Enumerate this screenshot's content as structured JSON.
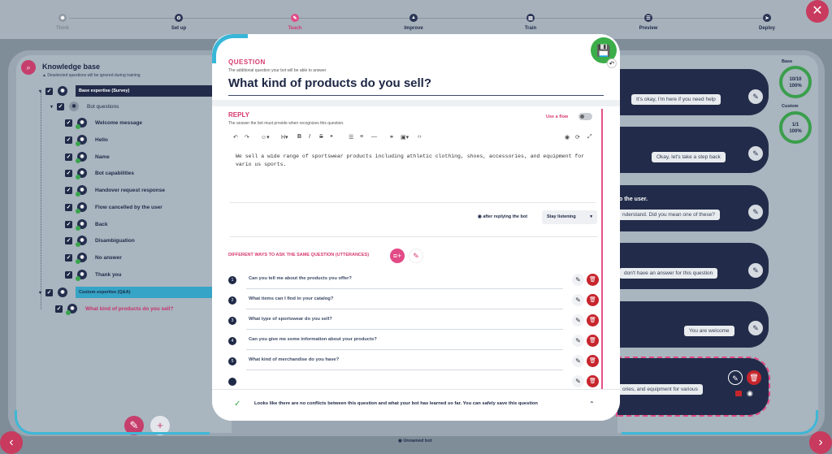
{
  "steps": [
    {
      "label": "Think",
      "icon": "✺"
    },
    {
      "label": "Set up",
      "icon": "⚙"
    },
    {
      "label": "Teach",
      "icon": "✎"
    },
    {
      "label": "Improve",
      "icon": "▲"
    },
    {
      "label": "Train",
      "icon": "▥"
    },
    {
      "label": "Preview",
      "icon": "☰"
    },
    {
      "label": "Deploy",
      "icon": "➤"
    }
  ],
  "knowledge_base": {
    "title": "Knowledge base",
    "subtitle": "▲ Deselected questions will be ignored during training",
    "base_category": "Base expertise (Survey)",
    "bot_questions": "Bot questions",
    "items": [
      "Welcome message",
      "Hello",
      "Name",
      "Bot capabilities",
      "Handover request response",
      "Flow cancelled by the user",
      "Back",
      "Disambiguation",
      "No answer",
      "Thank you"
    ],
    "custom_category": "Custom expertise (Q&A)",
    "custom_item": "What kind of products do you sell?"
  },
  "modal": {
    "question_label": "QUESTION",
    "question_hint": "The additional question your bot will be able to answer",
    "question_value": "What kind of products do you sell?",
    "reply_label": "REPLY",
    "reply_hint": "The answer the bot must provide when recognizes this question.",
    "use_flow": "Use a flow",
    "reply_text": "We sell a wide range of sportswear products including athletic clothing, shoes, accessories, and equipment for vario us sports.",
    "after_reply": "after replying the bot",
    "after_select": "Stay listening",
    "utterances_label": "DIFFERENT WAYS TO ASK THE SAME QUESTION (UTTERANCES)",
    "utterances": [
      {
        "n": "1",
        "text": "Can you tell me about the products you offer?"
      },
      {
        "n": "2",
        "text": "What items can I find in your catalog?"
      },
      {
        "n": "3",
        "text": "What type of sportswear do you sell?"
      },
      {
        "n": "4",
        "text": "Can you give me some information about your products?"
      },
      {
        "n": "5",
        "text": "What kind of merchandise do you have?"
      }
    ],
    "banner": "Looks like there are no conflicts between this question and what your bot has learned so far. You can safely save this question"
  },
  "right": {
    "gauge_base_label": "Base",
    "gauge_base": "10/10",
    "gauge_base_pct": "100%",
    "gauge_custom_label": "Custom",
    "gauge_custom": "1/1",
    "gauge_custom_pct": "100%",
    "replies": [
      "It's okay, I'm here if you need help",
      "Okay, let's take a step back",
      "nderstand. Did you mean one of these?",
      "don't have an answer for this question",
      "You are welcome",
      "ories, and equipment for various"
    ],
    "user_text": "o the user."
  },
  "footer": {
    "bot_name": "Unnamed bot"
  }
}
